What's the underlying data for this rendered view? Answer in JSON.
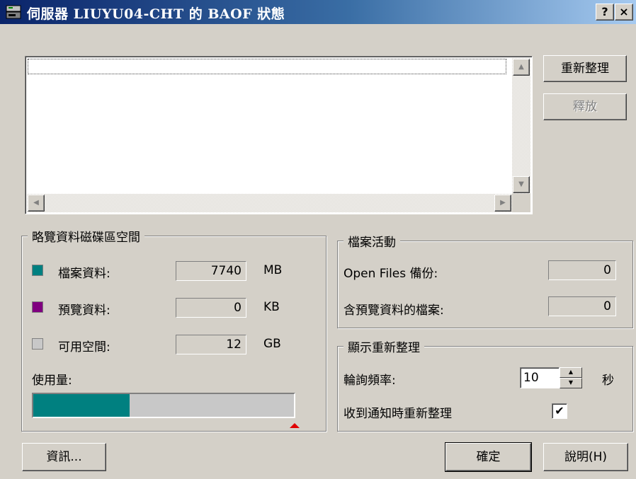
{
  "window": {
    "title": "伺服器 LIUYU04-CHT 的 BAOF 狀態",
    "help_button": "?",
    "close_button": "×"
  },
  "actions": {
    "refresh": "重新整理",
    "release": "釋放",
    "info": "資訊...",
    "ok": "確定",
    "help": "說明(H)"
  },
  "disk_space": {
    "title": "略覽資料磁碟區空間",
    "rows": [
      {
        "label": "檔案資料:",
        "value": "7740",
        "unit": "MB",
        "color": "#008080"
      },
      {
        "label": "預覽資料:",
        "value": "0",
        "unit": "KB",
        "color": "#800080"
      },
      {
        "label": "可用空間:",
        "value": "12",
        "unit": "GB",
        "color": "#c8c8c8"
      }
    ],
    "usage_label": "使用量:",
    "usage_fraction": 0.37
  },
  "file_activity": {
    "title": "檔案活動",
    "open_files_label": "Open Files 備份:",
    "open_files_value": "0",
    "preview_files_label": "含預覽資料的檔案:",
    "preview_files_value": "0"
  },
  "display_refresh": {
    "title": "顯示重新整理",
    "poll_label": "輪詢頻率:",
    "poll_value": "10",
    "poll_unit": "秒",
    "notify_label": "收到通知時重新整理",
    "notify_checked": true
  }
}
